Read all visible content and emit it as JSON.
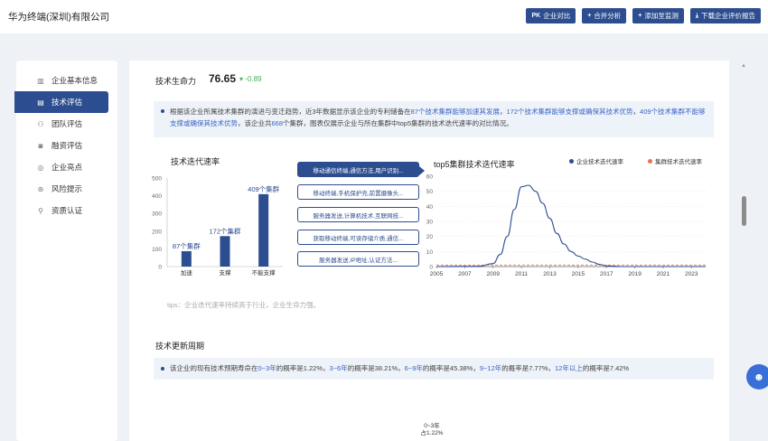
{
  "header": {
    "company": "华为终端(深圳)有限公司",
    "buttons": [
      {
        "icon": "PK",
        "label": "企业对比"
      },
      {
        "icon": "+",
        "label": "合并分析"
      },
      {
        "icon": "+",
        "label": "添加至监测"
      },
      {
        "icon": "⤓",
        "label": "下载企业评价报告"
      }
    ]
  },
  "sidebar": {
    "items": [
      {
        "icon": "building-icon",
        "glyph": "▥",
        "label": "企业基本信息"
      },
      {
        "icon": "tech-icon",
        "glyph": "▤",
        "label": "技术评估"
      },
      {
        "icon": "team-icon",
        "glyph": "⚇",
        "label": "团队评估"
      },
      {
        "icon": "money-bag-icon",
        "glyph": "◙",
        "label": "融资评估"
      },
      {
        "icon": "medal-icon",
        "glyph": "◎",
        "label": "企业亮点"
      },
      {
        "icon": "alert-icon",
        "glyph": "⊛",
        "label": "风险提示"
      },
      {
        "icon": "cert-icon",
        "glyph": "⚲",
        "label": "资质认证"
      }
    ],
    "active_index": 1
  },
  "vitality": {
    "title": "技术生命力",
    "score": "76.65",
    "delta": "▾ -0.89",
    "info_parts": [
      {
        "t": "根据该企业所属技术集群的演进与变迁趋势，近3年数据显示该企业的专利储备在",
        "hl": false
      },
      {
        "t": "87个技术集群能够加速其发展",
        "hl": true
      },
      {
        "t": "，",
        "hl": false
      },
      {
        "t": "172个技术集群能够支撑或确保其技术优势",
        "hl": true
      },
      {
        "t": "，",
        "hl": false
      },
      {
        "t": "409个技术集群不能够支撑或确保其技术优势",
        "hl": true
      },
      {
        "t": "，该企业共",
        "hl": false
      },
      {
        "t": "668",
        "hl": true
      },
      {
        "t": "个集群，图表仅展示企业与所在集群中top5集群的技术迭代速率的对比情况。",
        "hl": false
      }
    ]
  },
  "chart_data": [
    {
      "type": "bar",
      "title": "技术迭代速率",
      "categories": [
        "加速",
        "支撑",
        "不能支撑"
      ],
      "values": [
        87,
        172,
        409
      ],
      "data_labels": [
        "87个集群",
        "172个集群",
        "409个集群"
      ],
      "ylim": [
        0,
        500
      ],
      "yticks": [
        0,
        100,
        200,
        300,
        400,
        500
      ],
      "color": "#2c4d8f"
    },
    {
      "type": "line",
      "title": "top5集群技术迭代速率",
      "xlim": [
        2005,
        2024
      ],
      "ylim": [
        0,
        60
      ],
      "yticks": [
        0,
        10,
        20,
        30,
        40,
        50,
        60
      ],
      "xticks": [
        2005,
        2007,
        2009,
        2011,
        2013,
        2015,
        2017,
        2019,
        2021,
        2023
      ],
      "series": [
        {
          "name": "企业技术迭代速率",
          "color": "#2c4d8f",
          "x": [
            2005,
            2008,
            2009,
            2009.5,
            2010,
            2010.5,
            2011,
            2011.5,
            2012,
            2012.5,
            2013,
            2013.5,
            2014,
            2014.5,
            2015,
            2015.5,
            2016,
            2016.5,
            2017,
            2018,
            2024
          ],
          "y": [
            0,
            0.2,
            2,
            8,
            20,
            38,
            53,
            54,
            50,
            42,
            32,
            22,
            15,
            10,
            7,
            5,
            3,
            1.5,
            0.5,
            0,
            0
          ]
        },
        {
          "name": "集群技术迭代速率",
          "color": "#e8714f",
          "dashed": true,
          "x": [
            2005,
            2024
          ],
          "y": [
            1,
            1
          ]
        }
      ],
      "legend": "top-right"
    },
    {
      "type": "pie",
      "labels": [
        "0~3年"
      ],
      "values": [
        1.22
      ]
    }
  ],
  "clusters": [
    "移动通信终端,通信方法,用户识别...",
    "移动终端,手机保护壳,前置摄像头...",
    "服务器发送,计算机技术,互联网技...",
    "获取移动终端,可读存储介质,通信...",
    "服务器发送,IP地址,认证方法..."
  ],
  "tips": "tips：企业迭代速率持续高于行业，企业生命力强。",
  "update_cycle": {
    "title": "技术更新周期",
    "info_parts": [
      {
        "t": "该企业的现有技术预期寿命在",
        "hl": false
      },
      {
        "t": "0~3年",
        "hl": true
      },
      {
        "t": "的概率是1.22%，",
        "hl": false
      },
      {
        "t": "3~6年",
        "hl": true
      },
      {
        "t": "的概率是38.21%，",
        "hl": false
      },
      {
        "t": "6~9年",
        "hl": true
      },
      {
        "t": "的概率是45.38%，",
        "hl": false
      },
      {
        "t": "9~12年",
        "hl": true
      },
      {
        "t": "的概率是7.77%，",
        "hl": false
      },
      {
        "t": "12年以上",
        "hl": true
      },
      {
        "t": "的概率是7.42%",
        "hl": false
      }
    ],
    "pie_label_1": "0~3年",
    "pie_label_2": "占1.22%"
  }
}
